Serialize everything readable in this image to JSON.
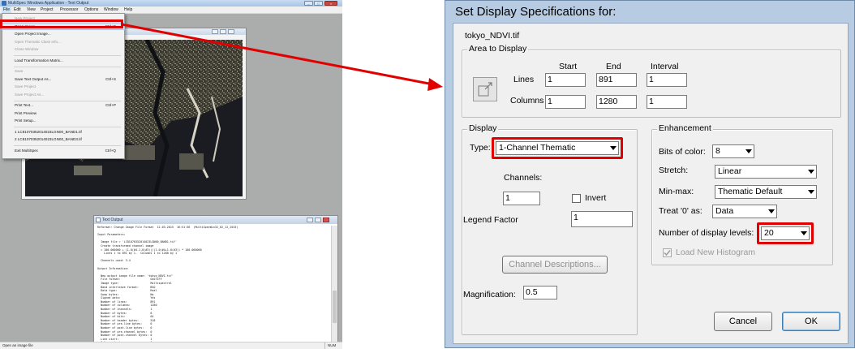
{
  "left_app": {
    "title": "MultiSpec Windows Application - Text Output",
    "menubar": [
      "File",
      "Edit",
      "View",
      "Project",
      "Processor",
      "Options",
      "Window",
      "Help"
    ],
    "file_menu": [
      {
        "label": "New Project",
        "shortcut": "",
        "disabled": true
      },
      {
        "label": "Open Image...",
        "shortcut": "Ctrl+O",
        "disabled": false
      },
      {
        "label": "Open Project Image...",
        "shortcut": "",
        "disabled": false
      },
      {
        "label": "Open Thematic Class Info...",
        "shortcut": "",
        "disabled": true
      },
      {
        "label": "Close Window",
        "shortcut": "",
        "disabled": true
      },
      {
        "label": "Load Transformation Matrix...",
        "shortcut": "",
        "disabled": false
      },
      {
        "label": "Save",
        "shortcut": "",
        "disabled": true
      },
      {
        "label": "Save Text Output As...",
        "shortcut": "Ctrl+S",
        "disabled": false
      },
      {
        "label": "Save Project",
        "shortcut": "",
        "disabled": true
      },
      {
        "label": "Save Project As...",
        "shortcut": "",
        "disabled": true
      },
      {
        "label": "Print Text...",
        "shortcut": "Ctrl+P",
        "disabled": false
      },
      {
        "label": "Print Preview",
        "shortcut": "",
        "disabled": false
      },
      {
        "label": "Print Setup...",
        "shortcut": "",
        "disabled": false
      },
      {
        "label": "1 LC81070352014023LGN00_BAND1.tif",
        "shortcut": "",
        "disabled": false
      },
      {
        "label": "2 LC81070352014023LGN00_BAND3.tif",
        "shortcut": "",
        "disabled": false
      },
      {
        "label": "Exit MultiSpec",
        "shortcut": "Ctrl+Q",
        "disabled": false
      }
    ],
    "status_text": "Open an image file",
    "status_pos": "NUM",
    "text_window": {
      "title": "Text Output",
      "lines": [
        "Reformat: Change Image File Format  12-03-2015  16:51:36  (MultiSpecWin32_02_12_2015)",
        "",
        "Input Parameters:",
        "",
        "  Image file = 'LC81070352014023LGN00_BAND1.tif'",
        "  Create transformed channel image",
        "  = 100.000000 + (1.0(#4-1.0(#3))/(1.0(#4+1.0(#3)) * 100.000000",
        "    Lines 1 to 891 by 1.  Columns 1 to 1280 by 1",
        "",
        "  Channels used: 3-4",
        "",
        "Output Information:",
        "",
        "  New output image file name: 'tokyo_NDVI.tif'",
        "  File format:                  GeoTIFF",
        "  Image type:                   Multispectral",
        "  Band interleave format:       BSQ",
        "  Data type:                    Real",
        "  Swap bytes:                   No",
        "  Signed data:                  Yes",
        "  Number of lines:              891",
        "  Number of columns:            1280",
        "  Number of channels:           1",
        "  Number of bytes:              8",
        "  Number of bits:               64",
        "  Number of header bytes:       518",
        "  Number of pre-line bytes:     0",
        "  Number of post-line bytes:    0",
        "  Number of pre-channel bytes:  0",
        "  Number of post-channel bytes: 0",
        "  Line start:                   1",
        "  Column start:                 1",
        "",
        "  85.686 is lowest calculated value",
        "  178.245 is highest calculated value"
      ]
    }
  },
  "dialog": {
    "title": "Set Display Specifications for:",
    "file_name": "tokyo_NDVI.tif",
    "area_group_title": "Area to Display",
    "col_headers": {
      "start": "Start",
      "end": "End",
      "interval": "Interval"
    },
    "lines_label": "Lines",
    "lines": {
      "start": "1",
      "end": "891",
      "interval": "1"
    },
    "columns_label": "Columns",
    "columns": {
      "start": "1",
      "end": "1280",
      "interval": "1"
    },
    "display_group_title": "Display",
    "type_label": "Type:",
    "type_value": "1-Channel Thematic",
    "channels_label": "Channels:",
    "channels_value": "1",
    "invert_label": "Invert",
    "legend_label": "Legend Factor",
    "legend_value": "1",
    "channel_desc_button": "Channel Descriptions...",
    "magnification_label": "Magnification:",
    "magnification_value": "0.5",
    "enh_group_title": "Enhancement",
    "bits_label": "Bits of color:",
    "bits_value": "8",
    "stretch_label": "Stretch:",
    "stretch_value": "Linear",
    "minmax_label": "Min-max:",
    "minmax_value": "Thematic Default",
    "treat_label": "Treat '0' as:",
    "treat_value": "Data",
    "levels_label": "Number of display levels:",
    "levels_value": "20",
    "load_hist_label": "Load New Histogram",
    "cancel_button": "Cancel",
    "ok_button": "OK"
  },
  "colors": {
    "highlight": "#e10000",
    "dialog_frame": "#b7cbe2"
  }
}
